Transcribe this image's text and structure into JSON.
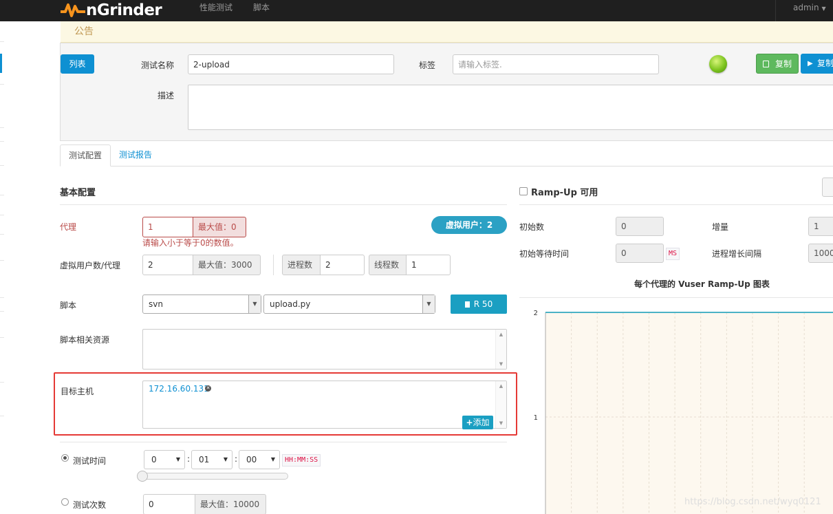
{
  "app": {
    "brand": "nGrinder"
  },
  "nav": {
    "items": [
      "性能测试",
      "脚本"
    ],
    "user": "admin"
  },
  "notice": {
    "text": "公告"
  },
  "header": {
    "list_btn": "列表",
    "test_name_label": "测试名称",
    "test_name_value": "2-upload",
    "tag_label": "标签",
    "tag_placeholder": "请输入标签.",
    "copy_btn": "复制",
    "copy_run_btn": "复制",
    "desc_label": "描述",
    "status_color": "#7dc41f"
  },
  "tabs": [
    {
      "label": "测试配置",
      "active": true
    },
    {
      "label": "测试报告",
      "active": false
    }
  ],
  "basic": {
    "title": "基本配置",
    "agent_label": "代理",
    "agent_value": "1",
    "agent_max": "最大值：0",
    "agent_error": "请输入小于等于0的数值。",
    "vuser_badge": "虚拟用户：2",
    "vusers_label": "虚拟用户数/代理",
    "vusers_value": "2",
    "vusers_max": "最大值：3000",
    "process_label": "进程数",
    "process_value": "2",
    "thread_label": "线程数",
    "thread_value": "1",
    "script_label": "脚本",
    "script_repo": "svn",
    "script_file": "upload.py",
    "revision_btn": "R 50",
    "resources_label": "脚本相关资源",
    "target_label": "目标主机",
    "target_hosts": [
      "172.16.60.131"
    ],
    "add_btn": "添加",
    "duration_label": "测试时间",
    "duration_hh": "0",
    "duration_mm": "01",
    "duration_ss": "00",
    "duration_format": "HH:MM:SS",
    "duration_selected": true,
    "count_label": "测试次数",
    "count_value": "0",
    "count_max": "最大值：10000"
  },
  "rampup": {
    "checkbox_label": "Ramp-Up 可用",
    "enabled": false,
    "initial_label": "初始数",
    "initial_value": "0",
    "increment_label": "增量",
    "increment_value": "1",
    "initial_wait_label": "初始等待时间",
    "initial_wait_value": "0",
    "ms_unit": "MS",
    "interval_label": "进程增长间隔",
    "interval_value": "1000"
  },
  "chart_data": {
    "type": "line",
    "title": "每个代理的 Vuser Ramp-Up 图表",
    "y_ticks": [
      "2",
      "1"
    ],
    "series": [
      {
        "values": [
          2,
          2,
          2,
          2,
          2,
          2,
          2,
          2,
          2,
          2,
          2
        ]
      }
    ]
  },
  "watermark": "https://blog.csdn.net/wyq0121"
}
